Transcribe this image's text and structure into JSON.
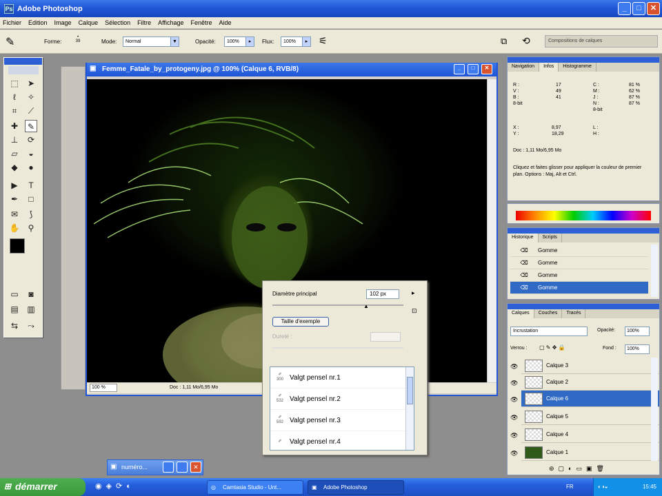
{
  "app": {
    "title": "Adobe Photoshop",
    "window_buttons": [
      "_",
      "□",
      "✕"
    ]
  },
  "menu": [
    "Fichier",
    "Edition",
    "Image",
    "Calque",
    "Sélection",
    "Filtre",
    "Affichage",
    "Fenêtre",
    "Aide"
  ],
  "options": {
    "forme_label": "Forme:",
    "mode_label": "Mode:",
    "mode_value": "Normal",
    "opacity_label": "Opacité:",
    "opacity_value": "100%",
    "flux_label": "Flux:",
    "flux_value": "100%",
    "compositions_label": "Compositions de calques",
    "brush_size": "39"
  },
  "document": {
    "title": "Femme_Fatale_by_protogeny.jpg @ 100% (Calque 6, RVB/8)",
    "zoom": "100 %",
    "status": "Doc : 1,11 Mo/6,95 Mo"
  },
  "brush_popup": {
    "diameter_label": "Diamètre principal",
    "diameter_value": "102 px",
    "sample_size_button": "Taille d'exemple",
    "hardness_label": "Dureté :",
    "brushes": [
      {
        "name": "Valgt pensel nr.1",
        "size": "300"
      },
      {
        "name": "Valgt pensel nr.2",
        "size": "532"
      },
      {
        "name": "Valgt pensel nr.3",
        "size": "592"
      },
      {
        "name": "Valgt pensel nr.4",
        "size": ""
      }
    ]
  },
  "info_panel": {
    "tabs": [
      "Navigation",
      "Infos",
      "Histogramme"
    ],
    "rgb_labels": [
      "R :",
      "V :",
      "B :"
    ],
    "rgb_values": [
      "17",
      "49",
      "41"
    ],
    "cmyk_labels": [
      "C :",
      "M :",
      "J :",
      "N :"
    ],
    "cmyk_values": [
      "81 %",
      "62 %",
      "87 %",
      "87 %"
    ],
    "bit_label_left": "8-bit",
    "bit_label_right": "8-bit",
    "x_label": "X :",
    "y_label": "Y :",
    "x_value": "8,97",
    "y_value": "18,29",
    "l_label": "L :",
    "h_label": "H :",
    "doc": "Doc : 1,11 Mo/6,95 Mo",
    "hint": "Cliquez et faites glisser pour appliquer la couleur de premier plan. Options : Maj, Alt et Ctrl."
  },
  "history_panel": {
    "tabs": [
      "Historique",
      "Scripts"
    ],
    "items": [
      "Gomme",
      "Gomme",
      "Gomme",
      "Gomme"
    ],
    "active_index": 3
  },
  "layers_panel": {
    "tabs": [
      "Calques",
      "Couches",
      "Tracés"
    ],
    "blend_mode": "Incrustation",
    "opacity_label": "Opacité:",
    "opacity_value": "100%",
    "lock_label": "Verrou :",
    "fill_label": "Fond :",
    "fill_value": "100%",
    "layers": [
      "Calque 3",
      "Calque 2",
      "Calque 6",
      "Calque 5",
      "Calque 4",
      "Calque 1"
    ],
    "active_index": 2
  },
  "mini_window": {
    "title": "numéro..."
  },
  "taskbar": {
    "start": "démarrer",
    "items": [
      "Camtasia Studio - Unt...",
      "Adobe Photoshop"
    ],
    "tray_lang": "FR",
    "clock": "15:45"
  },
  "colors": {
    "xp_blue": "#1f55d6",
    "panel_bg": "#ece9d8",
    "selection": "#316ac5"
  }
}
